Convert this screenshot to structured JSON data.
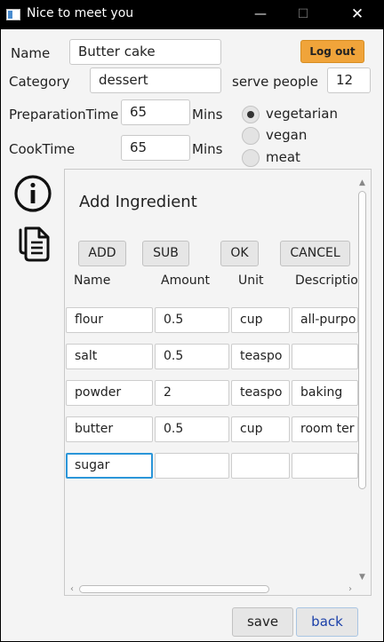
{
  "window": {
    "title": "Nice to meet you",
    "icons": [
      "minimize-icon",
      "maximize-icon",
      "close-icon"
    ]
  },
  "form": {
    "name_label": "Name",
    "name_value": "Butter cake",
    "category_label": "Category",
    "category_value": "dessert",
    "serve_label": "serve people",
    "serve_value": "12",
    "prep_label": "PreparationTime",
    "prep_value": "65",
    "prep_unit": "Mins",
    "cook_label": "CookTime",
    "cook_value": "65",
    "cook_unit": "Mins",
    "logout_label": "Log out",
    "diet_options": [
      {
        "label": "vegetarian",
        "selected": true
      },
      {
        "label": "vegan",
        "selected": false
      },
      {
        "label": "meat",
        "selected": false
      }
    ]
  },
  "side_icons": [
    "info-icon",
    "copy-icon"
  ],
  "ingredients": {
    "title": "Add Ingredient",
    "buttons": [
      "ADD",
      "SUB",
      "OK",
      "CANCEL"
    ],
    "columns": [
      "Name",
      "Amount",
      "Unit",
      "Descriptio"
    ],
    "rows": [
      {
        "name": "flour",
        "amount": "0.5",
        "unit": "cup",
        "description": "all-purpo"
      },
      {
        "name": "salt",
        "amount": "0.5",
        "unit": "teaspo",
        "description": ""
      },
      {
        "name": "powder",
        "amount": "2",
        "unit": "teaspo",
        "description": "baking"
      },
      {
        "name": "butter",
        "amount": "0.5",
        "unit": "cup",
        "description": "room ter"
      },
      {
        "name": "sugar",
        "amount": "",
        "unit": "",
        "description": ""
      }
    ]
  },
  "footer": {
    "save_label": "save",
    "back_label": "back"
  },
  "colors": {
    "accent_orange": "#f0a43a",
    "focus_blue": "#2b96d9",
    "link_blue": "#1a3fa8",
    "background": "#f4f4f4",
    "titlebar": "#000000"
  }
}
